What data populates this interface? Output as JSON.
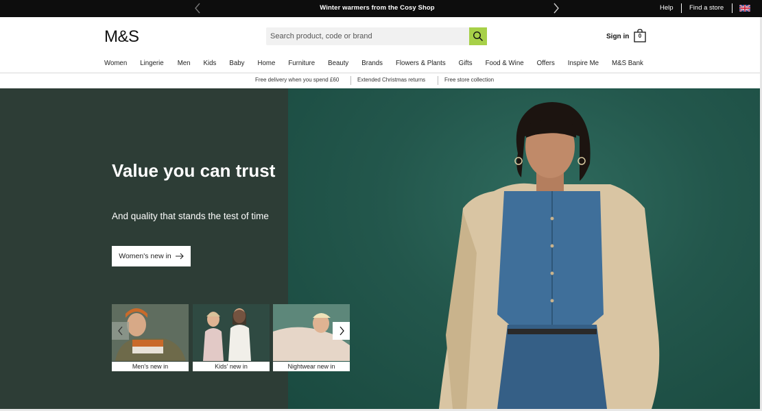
{
  "topbar": {
    "promo": "Winter warmers from the Cosy Shop",
    "help": "Help",
    "find_store": "Find a store"
  },
  "header": {
    "logo": "M&S",
    "search_placeholder": "Search product, code or brand",
    "signin": "Sign in",
    "bag_count": "0"
  },
  "nav": [
    "Women",
    "Lingerie",
    "Men",
    "Kids",
    "Baby",
    "Home",
    "Furniture",
    "Beauty",
    "Brands",
    "Flowers & Plants",
    "Gifts",
    "Food & Wine",
    "Offers",
    "Inspire Me",
    "M&S Bank"
  ],
  "benefits": [
    "Free delivery when you spend £60",
    "Extended Christmas returns",
    "Free store collection"
  ],
  "hero": {
    "title": "Value you can trust",
    "subtitle": "And quality that stands the test of time",
    "cta": "Women's new in"
  },
  "carousel": [
    "Men's new in",
    "Kids' new in",
    "Nightwear new in"
  ],
  "colors": {
    "accent_search": "#a7d048",
    "hero_left": "#2d3d36",
    "hero_right": "#23574c"
  },
  "icons": {
    "prev": "chevron-left-icon",
    "next": "chevron-right-icon",
    "search": "search-icon",
    "bag": "shopping-bag-icon",
    "flag": "uk-flag-icon",
    "arrow": "arrow-right-icon"
  }
}
